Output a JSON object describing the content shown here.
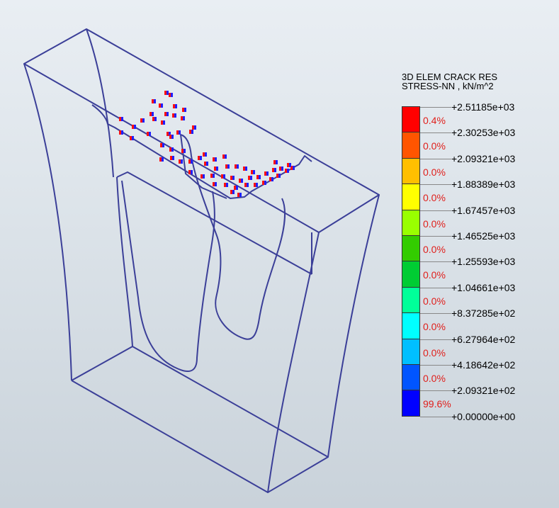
{
  "legend": {
    "title_line1": "3D ELEM CRACK RES",
    "title_line2": "STRESS-NN , kN/m^2",
    "ticks": [
      "+2.51185e+03",
      "+2.30253e+03",
      "+2.09321e+03",
      "+1.88389e+03",
      "+1.67457e+03",
      "+1.46525e+03",
      "+1.25593e+03",
      "+1.04661e+03",
      "+8.37285e+02",
      "+6.27964e+02",
      "+4.18642e+02",
      "+2.09321e+02",
      "+0.00000e+00"
    ],
    "percentages": [
      "0.4%",
      "0.0%",
      "0.0%",
      "0.0%",
      "0.0%",
      "0.0%",
      "0.0%",
      "0.0%",
      "0.0%",
      "0.0%",
      "0.0%",
      "99.6%"
    ],
    "colors": [
      "#ff0000",
      "#ff5500",
      "#ffbf00",
      "#ffff00",
      "#99ff00",
      "#33cc00",
      "#00cc33",
      "#00ff99",
      "#00ffff",
      "#00bfff",
      "#0055ff",
      "#0000ff"
    ]
  },
  "model": {
    "wire_color": "#3b3f98",
    "marker_colors": [
      "#ff1010",
      "#2020ff"
    ]
  }
}
